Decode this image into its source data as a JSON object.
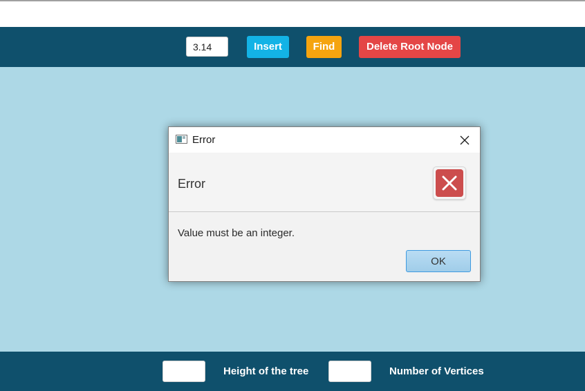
{
  "toolbar": {
    "value_input": "3.14",
    "insert_label": "Insert",
    "find_label": "Find",
    "delete_label": "Delete Root Node"
  },
  "dialog": {
    "title": "Error",
    "header": "Error",
    "message": "Value must be an integer.",
    "ok_label": "OK"
  },
  "status": {
    "height_value": "",
    "height_label": "Height of the tree",
    "vertices_value": "",
    "vertices_label": "Number of Vertices"
  },
  "icons": {
    "app": "app-window-icon",
    "close": "close-icon",
    "error": "error-x-icon"
  },
  "colors": {
    "canvas": "#add8e6",
    "bar": "#0f506c",
    "insert": "#13b3e6",
    "find": "#f5a40f",
    "delete": "#e44646",
    "error": "#cc4d4d"
  }
}
